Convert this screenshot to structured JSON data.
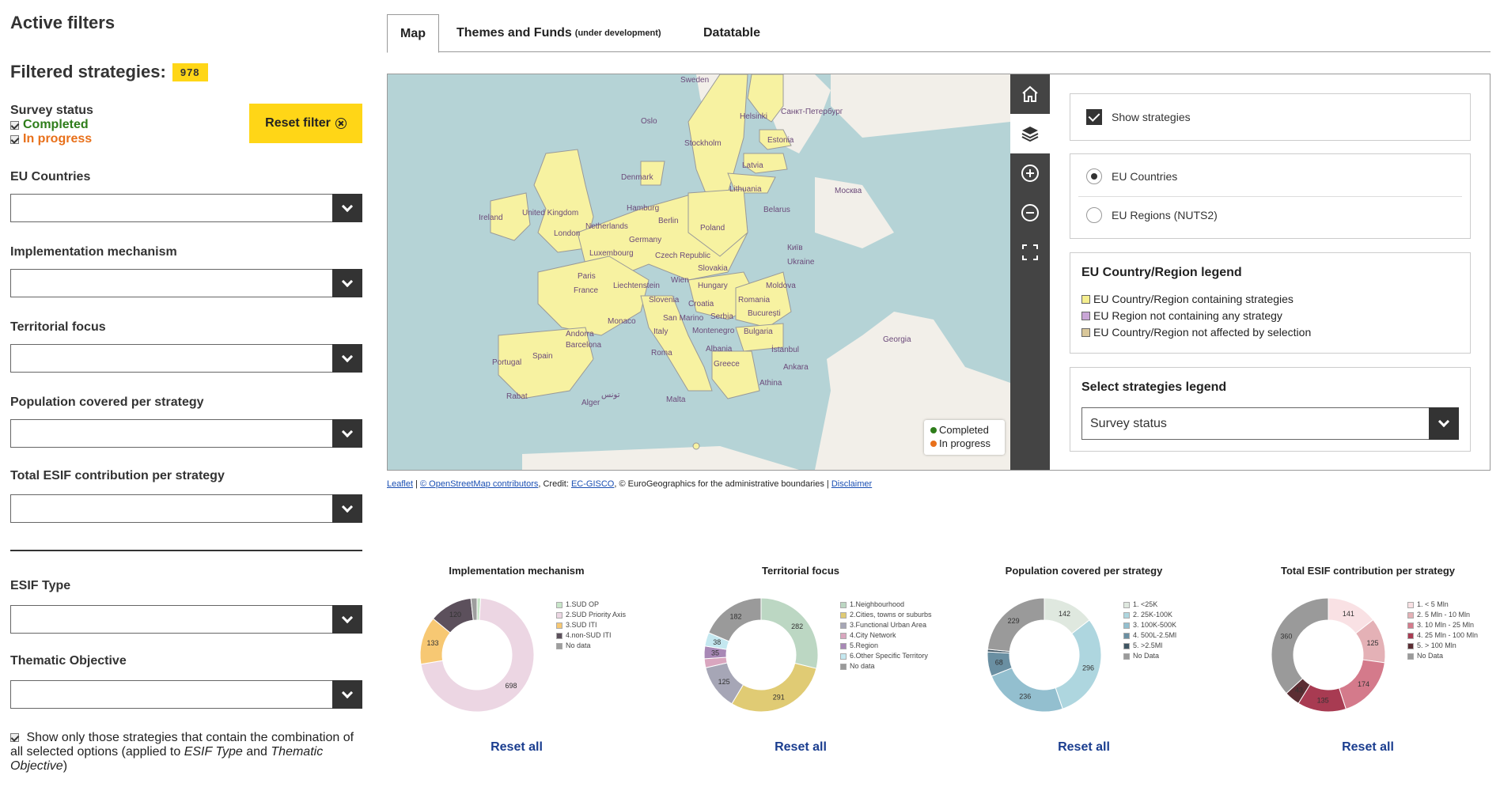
{
  "sidebar": {
    "active_filters_title": "Active filters",
    "filtered_strategies_label": "Filtered strategies:",
    "filtered_count": "978",
    "survey_status_title": "Survey status",
    "survey_completed": "Completed",
    "survey_in_progress": "In progress",
    "reset_filter_label": "Reset filter",
    "filters": [
      {
        "label": "EU Countries",
        "value": ""
      },
      {
        "label": "Implementation mechanism",
        "value": ""
      },
      {
        "label": "Territorial focus",
        "value": ""
      },
      {
        "label": "Population covered per strategy",
        "value": ""
      },
      {
        "label": "Total ESIF contribution per strategy",
        "value": ""
      },
      {
        "label": "ESIF Type",
        "value": ""
      },
      {
        "label": "Thematic Objective",
        "value": ""
      }
    ],
    "combo_text_1": "Show only those strategies that contain the combination of all selected options (applied to ",
    "combo_em_1": "ESIF Type",
    "combo_text_2": " and ",
    "combo_em_2": "Thematic Objective",
    "combo_text_3": ")"
  },
  "tabs": {
    "map": "Map",
    "themes": "Themes and Funds",
    "themes_note": "(under development)",
    "datatable": "Datatable"
  },
  "map": {
    "labels": [
      "Sweden",
      "Oslo",
      "Stockholm",
      "Helsinki",
      "Санкт-Петербург",
      "Estonia",
      "Latvia",
      "Denmark",
      "Lithuania",
      "Москва",
      "Ireland",
      "United Kingdom",
      "Hamburg",
      "Berlin",
      "Belarus",
      "London",
      "Netherlands",
      "Germany",
      "Poland",
      "Luxembourg",
      "Czech Republic",
      "Київ",
      "Paris",
      "Slovakia",
      "Ukraine",
      "France",
      "Liechtenstein",
      "Wien",
      "Hungary",
      "Moldova",
      "Slovenia",
      "Croatia",
      "Romania",
      "Monaco",
      "San Marino",
      "Serbia",
      "București",
      "Andorra",
      "Italy",
      "Montenegro",
      "Bulgaria",
      "Barcelona",
      "Georgia",
      "Spain",
      "Roma",
      "Albania",
      "İstanbul",
      "Portugal",
      "Greece",
      "Ankara",
      "Rabat",
      "تونس",
      "Alger",
      "Malta",
      "Athina"
    ],
    "legend_completed": "Completed",
    "legend_in_progress": "In progress",
    "colors": {
      "sea": "#b5d3d6",
      "eu": "#f7f2a1",
      "land": "#f2efe9",
      "completed": "#2e7d1a",
      "in_progress": "#e8701a"
    }
  },
  "panel": {
    "show_strategies": "Show strategies",
    "radio_countries": "EU Countries",
    "radio_regions": "EU Regions (NUTS2)",
    "legend_title": "EU Country/Region legend",
    "legend_items": [
      {
        "label": "EU Country/Region containing strategies",
        "color": "#f5ee8f"
      },
      {
        "label": "EU Region not containing any strategy",
        "color": "#c9a6d6"
      },
      {
        "label": "EU Country/Region not affected by selection",
        "color": "#d9c79a"
      }
    ],
    "select_legend_title": "Select strategies legend",
    "select_legend_value": "Survey status"
  },
  "attribution": {
    "leaflet": "Leaflet",
    "sep1": " | ",
    "osm": "© OpenStreetMap contributors",
    "credit": ", Credit: ",
    "gisco": "EC-GISCO",
    "rest": ", © EuroGeographics for the administrative boundaries | ",
    "disclaimer": "Disclaimer"
  },
  "charts_common": {
    "reset_label": "Reset all"
  },
  "chart_data": [
    {
      "type": "pie",
      "title": "Implementation mechanism",
      "categories": [
        "1.SUD OP",
        "2.SUD Priority Axis",
        "3.SUD ITI",
        "4.non-SUD ITI",
        "No data"
      ],
      "values": [
        10,
        698,
        133,
        120,
        17
      ],
      "data_labels": [
        "",
        "698",
        "133",
        "120",
        ""
      ],
      "colors": [
        "#c8e6c9",
        "#ecd6e3",
        "#f7c873",
        "#5c505c",
        "#9e9e9e"
      ]
    },
    {
      "type": "pie",
      "title": "Territorial focus",
      "categories": [
        "1.Neighbourhood",
        "2.Cities, towns or suburbs",
        "3.Functional Urban Area",
        "4.City Network",
        "5.Region",
        "6.Other Specific Territory",
        "No data"
      ],
      "values": [
        282,
        291,
        125,
        25,
        35,
        38,
        182
      ],
      "data_labels": [
        "282",
        "291",
        "125",
        "",
        "35",
        "38",
        "182"
      ],
      "colors": [
        "#bcd7c3",
        "#e0cb74",
        "#a6a6b6",
        "#d9a6bf",
        "#a888b6",
        "#c4e8f0",
        "#9a9a9a"
      ]
    },
    {
      "type": "pie",
      "title": "Population covered per strategy",
      "categories": [
        "1. <25K",
        "2. 25K-100K",
        "3. 100K-500K",
        "4. 500L-2.5Ml",
        "5. >2.5Ml",
        "No Data"
      ],
      "values": [
        142,
        296,
        236,
        68,
        7,
        229
      ],
      "data_labels": [
        "142",
        "296",
        "236",
        "68",
        "",
        "229"
      ],
      "colors": [
        "#dfe8df",
        "#aed6df",
        "#93bfcf",
        "#6a8fa2",
        "#3f5563",
        "#9a9a9a"
      ]
    },
    {
      "type": "pie",
      "title": "Total ESIF contribution per strategy",
      "categories": [
        "1. < 5 Mln",
        "2. 5 Mln - 10 Mln",
        "3. 10 Mln - 25 Mln",
        "4. 25 Mln - 100 Mln",
        "5. > 100 Mln",
        "No Data"
      ],
      "values": [
        141,
        125,
        174,
        135,
        43,
        360
      ],
      "data_labels": [
        "141",
        "125",
        "174",
        "135",
        "43",
        "360"
      ],
      "colors": [
        "#f9e1e4",
        "#e4b1b6",
        "#d47a8b",
        "#a83b52",
        "#5b2d33",
        "#9a9a9a"
      ]
    }
  ]
}
